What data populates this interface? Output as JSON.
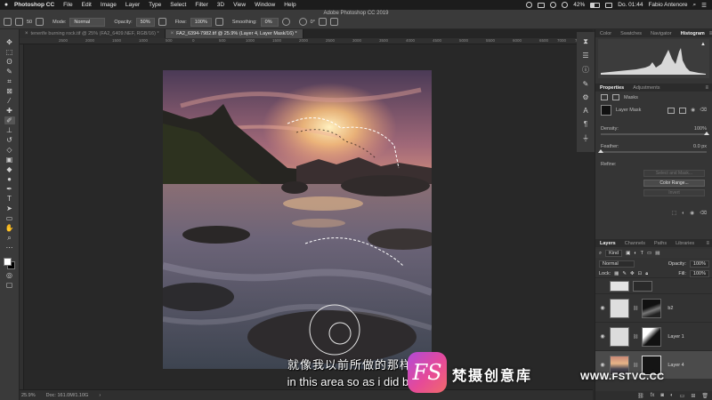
{
  "menubar": {
    "app": "Photoshop CC",
    "items": [
      "File",
      "Edit",
      "Image",
      "Layer",
      "Type",
      "Select",
      "Filter",
      "3D",
      "View",
      "Window",
      "Help"
    ],
    "battery": "42%",
    "clock": "Do. 01:44",
    "user": "Fabio Antenore"
  },
  "options": {
    "window_title": "Adobe Photoshop CC 2019",
    "brush_size": "50",
    "mode_label": "Mode:",
    "mode_value": "Normal",
    "opacity_label": "Opacity:",
    "opacity_value": "50%",
    "flow_label": "Flow:",
    "flow_value": "100%",
    "smoothing_label": "Smoothing:",
    "smoothing_value": "0%",
    "angle_value": "0°"
  },
  "tabs": [
    {
      "label": "tenerife burning rock.tif @ 25% (FA2_6409.NEF, RGB/16) *"
    },
    {
      "label": "FA2_6394-7982.tif @ 25.9% (Layer 4, Layer Mask/16) *"
    }
  ],
  "ruler": [
    "2500",
    "2000",
    "1500",
    "1000",
    "500",
    "0",
    "500",
    "1000",
    "1500",
    "2000",
    "2500",
    "3000",
    "3500",
    "4000",
    "4500",
    "5000",
    "5500",
    "6000",
    "6500",
    "7000",
    "7500"
  ],
  "status": {
    "zoom": "25.9%",
    "doc": "Doc: 161.0M/1.10G"
  },
  "panels": {
    "top_tabs": [
      "Color",
      "Swatches",
      "Navigator",
      "Histogram"
    ],
    "props_tabs": [
      "Properties",
      "Adjustments"
    ],
    "masks_label": "Masks",
    "layer_mask_label": "Layer Mask",
    "density_label": "Density:",
    "density_value": "100%",
    "feather_label": "Feather:",
    "feather_value": "0.0 px",
    "refine_label": "Refine:",
    "select_mask_button": "Select and Mask...",
    "color_range_button": "Color Range...",
    "invert_button": "Invert"
  },
  "layers_panel": {
    "tabs": [
      "Layers",
      "Channels",
      "Paths",
      "Libraries"
    ],
    "kind_label": "Kind",
    "blend_mode": "Normal",
    "opacity_label": "Opacity:",
    "opacity_value": "100%",
    "lock_label": "Lock:",
    "fill_label": "Fill:",
    "fill_value": "100%",
    "layers": [
      {
        "name": "b2"
      },
      {
        "name": "Layer 1"
      },
      {
        "name": "Layer 4"
      }
    ]
  },
  "subtitles": {
    "cn": "就像我以前所做的那样，",
    "en": "in this area so as i did befo"
  },
  "watermark": {
    "logo": "FS",
    "cn": "梵摄创意库",
    "url": "WWW.FSTVC.CC"
  },
  "colors": {
    "foreground": "#ffffff",
    "background": "#000000",
    "watermark_gradient_start": "#b14ad8",
    "watermark_gradient_end": "#f06a6a"
  }
}
